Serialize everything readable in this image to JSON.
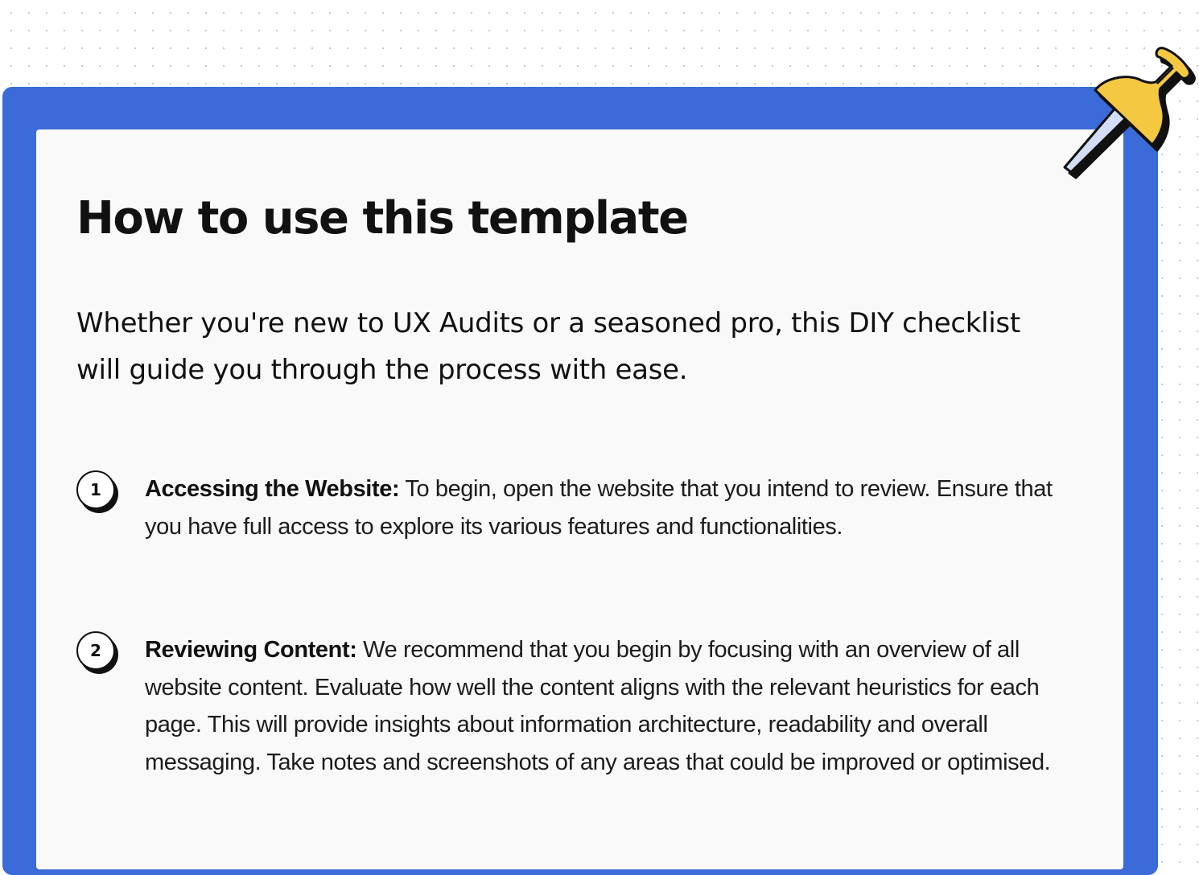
{
  "card": {
    "title": "How to use this template",
    "intro": "Whether you're new to UX Audits or a seasoned pro, this DIY checklist will guide you through the process with ease."
  },
  "steps": [
    {
      "number": "1",
      "heading": "Accessing the Website:",
      "body": "To begin, open the website that you intend to review. Ensure that you have full access to explore its various features and functionalities."
    },
    {
      "number": "2",
      "heading": "Reviewing Content:",
      "body": "We recommend that you begin by focusing with an overview of all website content. Evaluate how well the content aligns with the relevant heuristics for each page. This will provide insights about information architecture, readability and overall messaging. Take notes and screenshots of any areas that could be improved or optimised."
    }
  ],
  "colors": {
    "frame": "#3b6bd8",
    "card": "#f9f9f9",
    "pin_head": "#f5c842",
    "pin_needle": "#d5dcf7",
    "text": "#111111"
  },
  "icons": {
    "pin": "push-pin-icon"
  }
}
